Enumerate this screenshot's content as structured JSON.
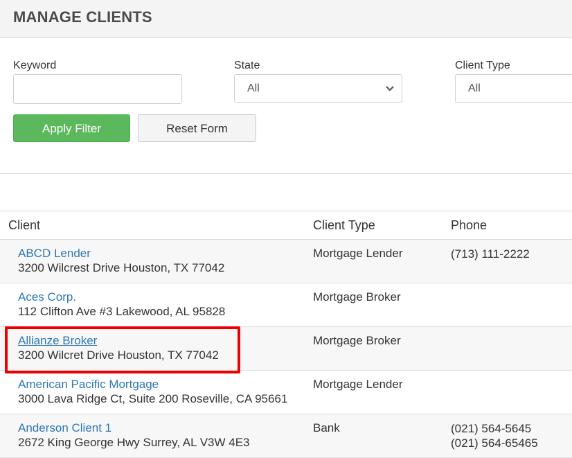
{
  "header": {
    "title": "MANAGE CLIENTS"
  },
  "filters": {
    "keyword": {
      "label": "Keyword",
      "value": "",
      "placeholder": ""
    },
    "state": {
      "label": "State",
      "selected": "All"
    },
    "client_type": {
      "label": "Client Type",
      "selected": "All"
    },
    "apply_label": "Apply Filter",
    "reset_label": "Reset Form"
  },
  "table": {
    "columns": [
      "Client",
      "Client Type",
      "Phone"
    ],
    "rows": [
      {
        "name": "ABCD Lender",
        "address": "3200 Wilcrest Drive Houston, TX 77042",
        "type": "Mortgage Lender",
        "phones": [
          "(713) 111-2222"
        ]
      },
      {
        "name": "Aces Corp.",
        "address": "112 Clifton Ave #3 Lakewood, AL 95828",
        "type": "Mortgage Broker",
        "phones": []
      },
      {
        "name": "Allianze Broker",
        "address": "3200 Wilcret Drive Houston, TX 77042",
        "type": "Mortgage Broker",
        "phones": []
      },
      {
        "name": "American Pacific Mortgage",
        "address": "3000 Lava Ridge Ct, Suite 200 Roseville, CA 95661",
        "type": "Mortgage Lender",
        "phones": []
      },
      {
        "name": "Anderson Client 1",
        "address": "2672 King George Hwy Surrey, AL V3W 4E3",
        "type": "Bank",
        "phones": [
          "(021) 564-5645",
          "(021) 564-65465"
        ]
      }
    ]
  },
  "colors": {
    "accent_green": "#5cb85c",
    "link_blue": "#2d77b5",
    "highlight_red": "#ee0000"
  }
}
